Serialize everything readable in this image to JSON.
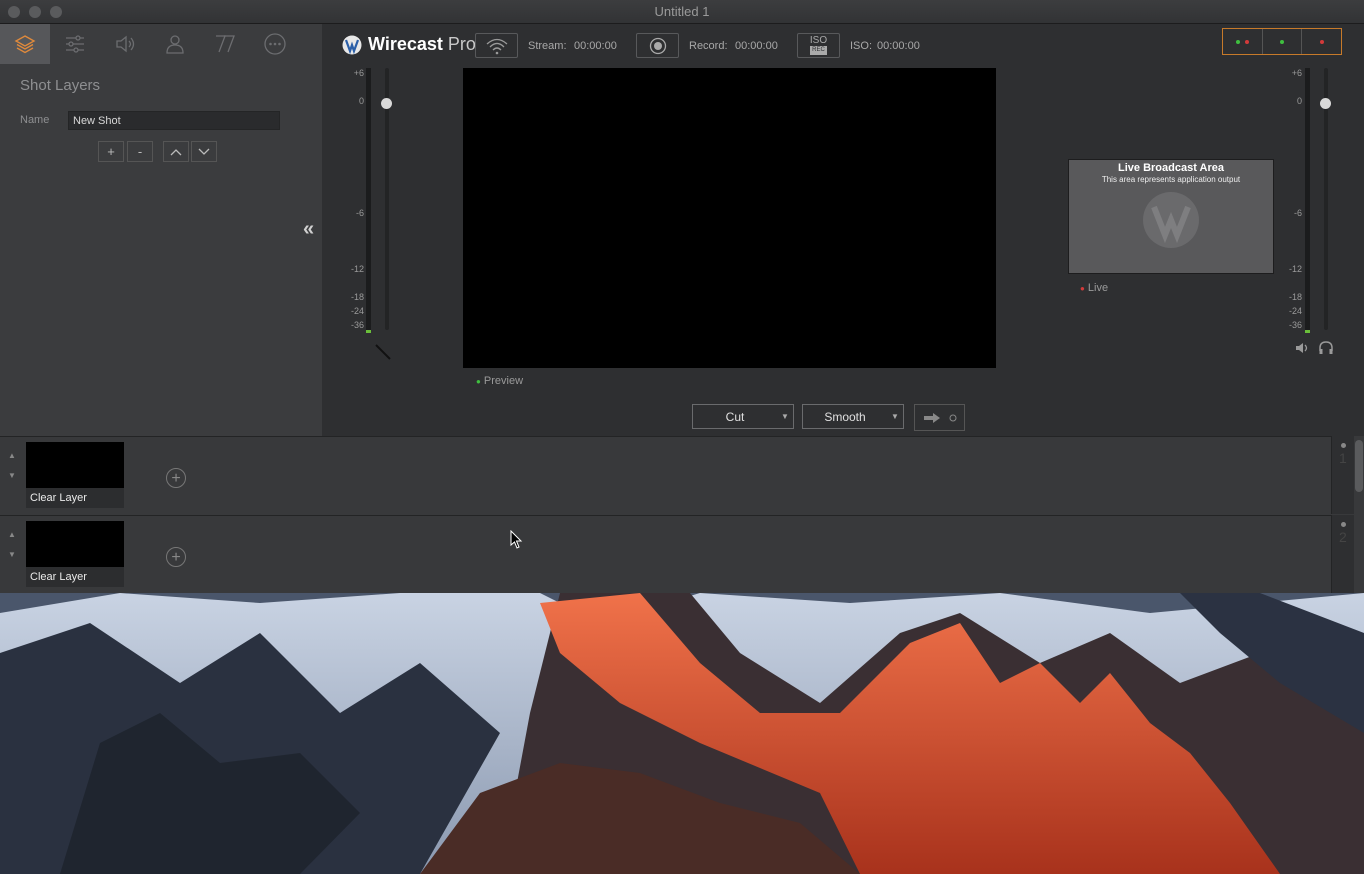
{
  "window": {
    "title": "Untitled 1"
  },
  "left_panel": {
    "tabs": [
      {
        "icon": "layers-icon",
        "active": true
      },
      {
        "icon": "sliders-icon",
        "active": false
      },
      {
        "icon": "speaker-icon",
        "active": false
      },
      {
        "icon": "person-icon",
        "active": false
      },
      {
        "icon": "title-icon",
        "active": false
      },
      {
        "icon": "more-icon",
        "active": false
      }
    ],
    "heading": "Shot Layers",
    "name_label": "Name",
    "name_value": "New Shot",
    "buttons": {
      "add": "+",
      "remove": "-"
    }
  },
  "toolbar": {
    "brand": "Wirecast",
    "brand_suffix": "Pro",
    "stream_label": "Stream:",
    "stream_time": "00:00:00",
    "record_label": "Record:",
    "record_time": "00:00:00",
    "iso_button_top": "ISO",
    "iso_button_bottom": "REC",
    "iso_label": "ISO:",
    "iso_time": "00:00:00"
  },
  "meter_scale": [
    "+6",
    "0",
    "-6",
    "-12",
    "-18",
    "-24",
    "-36"
  ],
  "preview": {
    "label": "Preview"
  },
  "live": {
    "title": "Live Broadcast Area",
    "subtitle": "This area represents application output",
    "label": "Live"
  },
  "transitions": {
    "transition_1": "Cut",
    "transition_2": "Smooth"
  },
  "layers": [
    {
      "caption": "Clear Layer",
      "number": "1"
    },
    {
      "caption": "Clear Layer",
      "number": "2"
    }
  ],
  "colors": {
    "accent_orange": "#c77a2a",
    "status_green": "#3fbf3f",
    "status_red": "#d33a3a"
  }
}
